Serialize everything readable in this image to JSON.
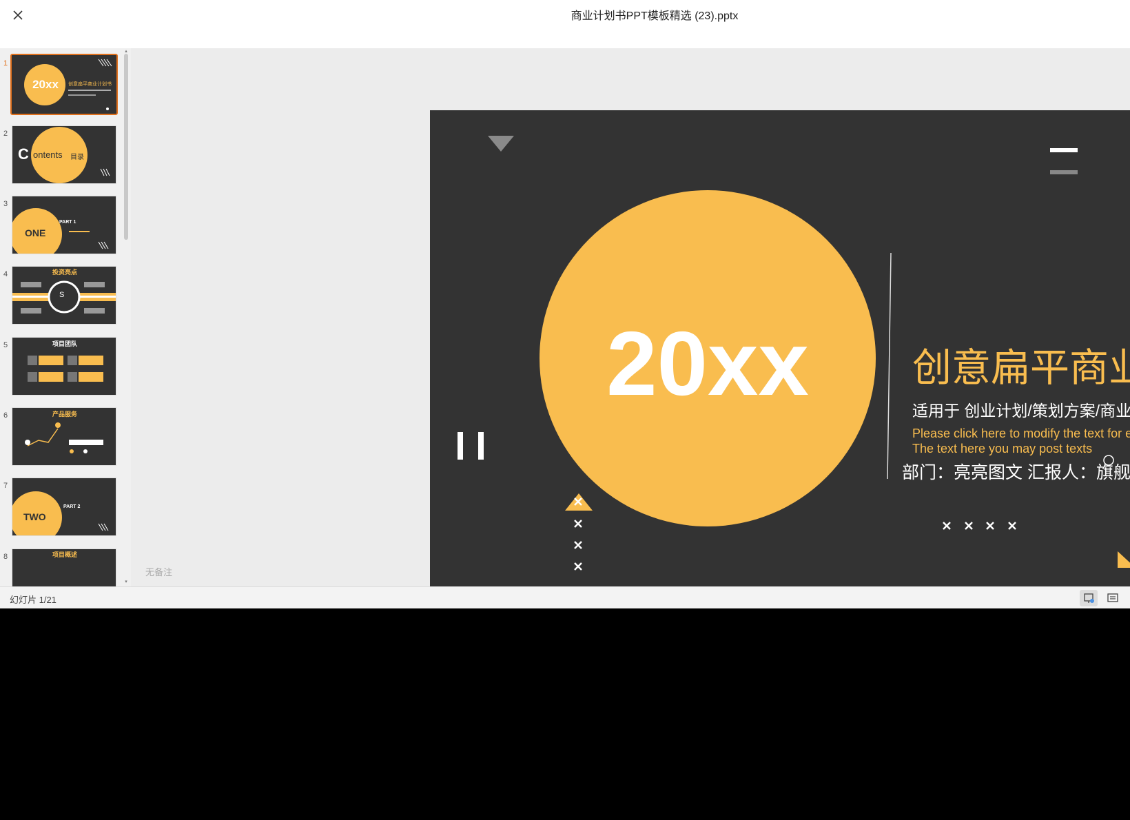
{
  "window": {
    "title": "商业计划书PPT模板精选 (23).pptx",
    "close_icon": "close-icon"
  },
  "thumbnails": [
    {
      "num": "1",
      "big": "20xx",
      "caption": "创意扁平商业计划书"
    },
    {
      "num": "2",
      "big": "ontents",
      "big_prefix": "C",
      "caption": "目录"
    },
    {
      "num": "3",
      "big": "ONE",
      "caption": "PART 1"
    },
    {
      "num": "4",
      "big": "S",
      "caption": "投资亮点"
    },
    {
      "num": "5",
      "big": "",
      "caption": "项目团队"
    },
    {
      "num": "6",
      "big": "",
      "caption": "产品服务"
    },
    {
      "num": "7",
      "big": "TWO",
      "caption": "PART 2"
    },
    {
      "num": "8",
      "big": "",
      "caption": "项目概述"
    }
  ],
  "slide": {
    "year": "20xx",
    "title": "创意扁平商业计划书",
    "subtitle": "适用于 创业计划/策划方案/商业规划/市场分析",
    "english_line1": "Please click here to modify the text for example",
    "english_line2": "The text here you may post texts",
    "dept": "部门：亮亮图文   汇报人：旗舰店"
  },
  "notes": {
    "placeholder": "无备注"
  },
  "status": {
    "slide_count": "幻灯片 1/21"
  },
  "colors": {
    "accent": "#f9bd4f",
    "slide_bg": "#333333",
    "active_border": "#e0701c"
  }
}
